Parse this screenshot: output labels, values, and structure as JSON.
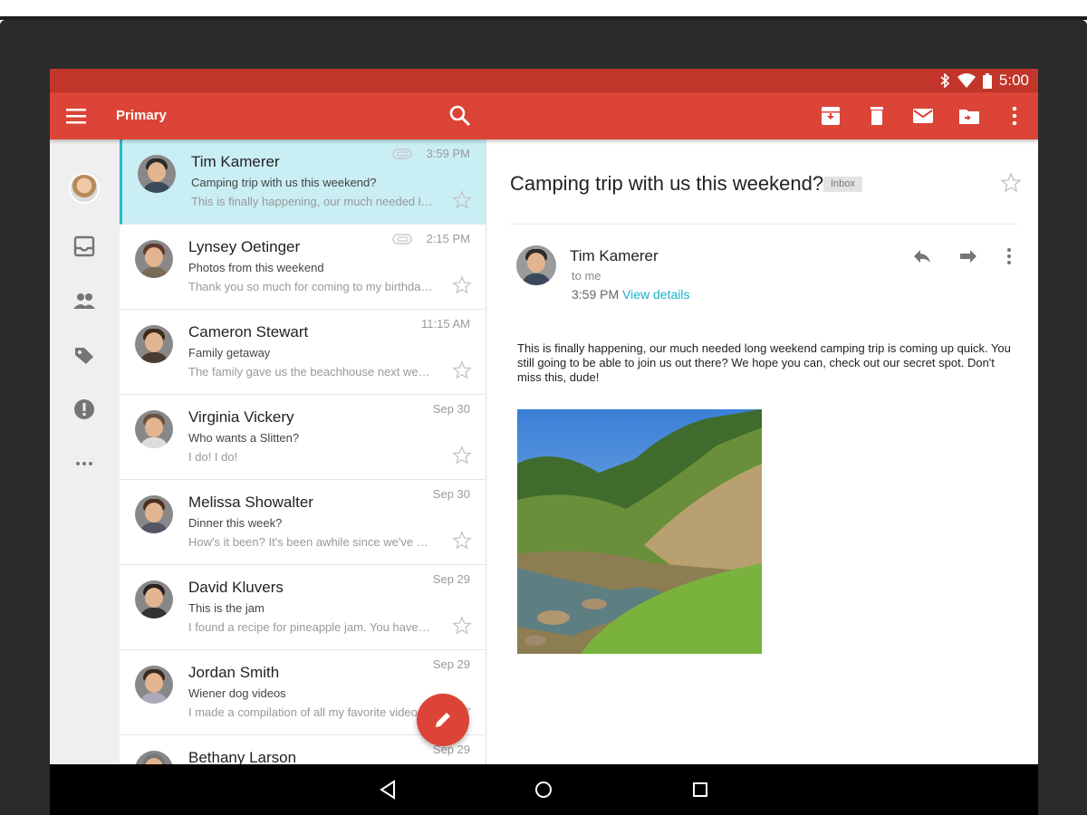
{
  "status_bar": {
    "time": "5:00"
  },
  "app_bar": {
    "title": "Primary"
  },
  "emails": [
    {
      "sender": "Tim Kamerer",
      "subject": "Camping trip with us this weekend?",
      "snippet": "This is finally happening, our much needed long weekend camping trip",
      "date": "3:59 PM",
      "has_attachment": true,
      "selected": true
    },
    {
      "sender": "Lynsey Oetinger",
      "subject": "Photos from this weekend",
      "snippet": "Thank you so much for coming to my birthday party",
      "date": "2:15 PM",
      "has_attachment": true,
      "selected": false
    },
    {
      "sender": "Cameron Stewart",
      "subject": "Family getaway",
      "snippet": "The family gave us the beachhouse next weekend",
      "date": "11:15 AM",
      "has_attachment": false,
      "selected": false
    },
    {
      "sender": "Virginia Vickery",
      "subject": "Who wants a Slitten?",
      "snippet": "I do! I do!",
      "date": "Sep 30",
      "has_attachment": false,
      "selected": false
    },
    {
      "sender": "Melissa Showalter",
      "subject": "Dinner this week?",
      "snippet": "How's it been? It's been awhile since we've gotten together",
      "date": "Sep 30",
      "has_attachment": false,
      "selected": false
    },
    {
      "sender": "David Kluvers",
      "subject": "This is the jam",
      "snippet": "I found a recipe for pineapple jam. You have to try it",
      "date": "Sep 29",
      "has_attachment": false,
      "selected": false
    },
    {
      "sender": "Jordan Smith",
      "subject": "Wiener dog videos",
      "snippet": "I made a compilation of all my favorite videos",
      "date": "Sep 29",
      "has_attachment": false,
      "selected": false
    },
    {
      "sender": "Bethany Larson",
      "subject": "",
      "snippet": "",
      "date": "Sep 29",
      "has_attachment": false,
      "selected": false
    }
  ],
  "reading_pane": {
    "subject": "Camping trip with us this weekend?",
    "label": "Inbox",
    "sender": "Tim Kamerer",
    "to": "to me",
    "time": "3:59 PM",
    "view_details": "View details",
    "body": "This is finally happening, our much needed long weekend camping trip is coming up quick. You still going to be able to join us out there? We hope you can, check out our secret spot. Don't miss this, dude!"
  },
  "colors": {
    "status_bar": "#c2352a",
    "app_bar": "#db4437",
    "accent": "#1bb0c8",
    "selected_row": "#c9eef4"
  },
  "icons": {
    "menu": "menu-icon",
    "search": "search-icon",
    "archive": "archive-icon",
    "delete": "delete-icon",
    "mark_unread": "mail-icon",
    "move": "move-to-folder-icon",
    "more": "more-vert-icon",
    "rail": [
      "inbox-icon",
      "people-icon",
      "label-icon",
      "alert-icon",
      "more-horiz-icon"
    ],
    "nav": [
      "back-icon",
      "home-icon",
      "recents-icon"
    ]
  }
}
